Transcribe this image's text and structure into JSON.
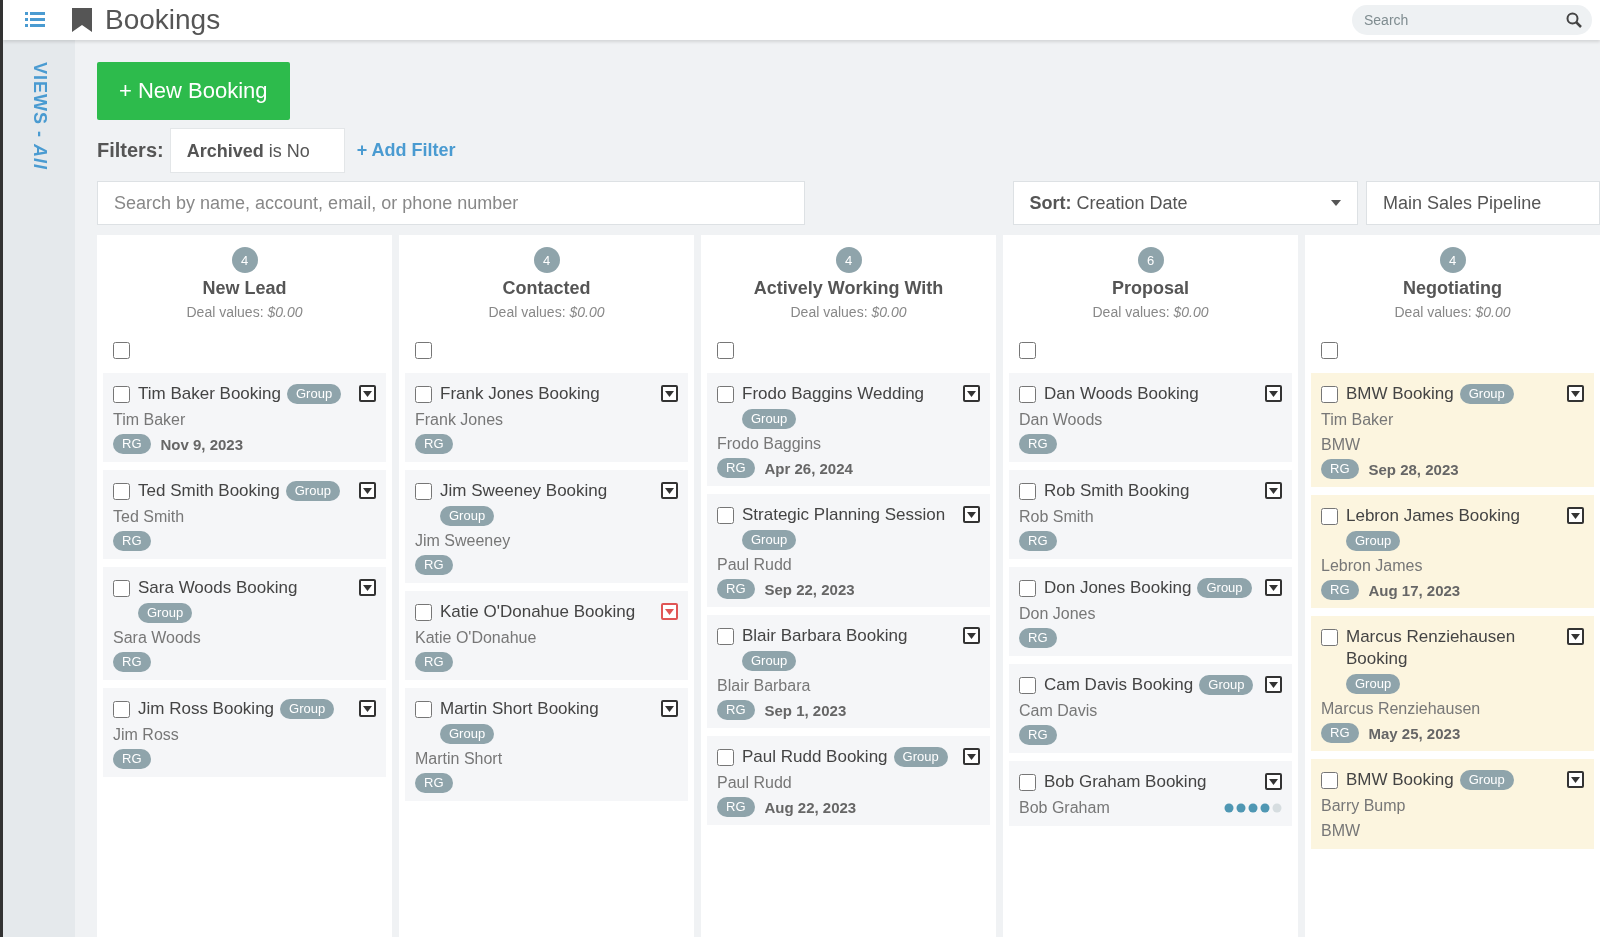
{
  "header": {
    "title": "Bookings",
    "search": {
      "placeholder": "Search"
    }
  },
  "sidebar": {
    "label": "VIEWS - *All*"
  },
  "toolbar": {
    "new_button": "+ New Booking",
    "filters_label": "Filters:",
    "filter": "**Archived** is No",
    "add_filter": "+ Add Filter",
    "search": {
      "placeholder": "Search by name, account, email, or phone number"
    },
    "sort": "**Sort:** Creation Date",
    "pipeline": "Main Sales Pipeline"
  },
  "columns": [
    {
      "count": "4",
      "name": "New Lead",
      "deal": "Deal values: *$0.00*",
      "checked": false,
      "cards": [
        {
          "title": "Tim Baker Booking",
          "badge": "Group",
          "contact": "Tim Baker",
          "tag": "RG",
          "date": "Nov 9, 2023",
          "checked": false,
          "flagged": false,
          "highlighted": false
        },
        {
          "title": "Ted Smith Booking",
          "badge": "Group",
          "contact": "Ted Smith",
          "tag": "RG",
          "checked": false,
          "flagged": false,
          "highlighted": false
        },
        {
          "title": "Sara Woods Booking",
          "badge": "Group",
          "contact": "Sara Woods",
          "tag": "RG",
          "checked": false,
          "flagged": false,
          "highlighted": false
        },
        {
          "title": "Jim Ross Booking",
          "badge": "Group",
          "contact": "Jim Ross",
          "tag": "RG",
          "checked": false,
          "flagged": false,
          "highlighted": false
        }
      ]
    },
    {
      "count": "4",
      "name": "Contacted",
      "deal": "Deal values: *$0.00*",
      "checked": false,
      "cards": [
        {
          "title": "Frank Jones Booking",
          "contact": "Frank Jones",
          "tag": "RG",
          "checked": false,
          "flagged": false,
          "highlighted": false
        },
        {
          "title": "Jim Sweeney Booking",
          "badge": "Group",
          "contact": "Jim Sweeney",
          "tag": "RG",
          "checked": false,
          "flagged": false,
          "highlighted": false
        },
        {
          "title": "Katie O'Donahue Booking",
          "contact": "Katie O'Donahue",
          "tag": "RG",
          "checked": false,
          "flagged": true,
          "highlighted": false
        },
        {
          "title": "Martin Short Booking",
          "badge": "Group",
          "contact": "Martin Short",
          "tag": "RG",
          "checked": false,
          "flagged": false,
          "highlighted": false
        }
      ]
    },
    {
      "count": "4",
      "name": "Actively Working With",
      "deal": "Deal values: *$0.00*",
      "checked": false,
      "cards": [
        {
          "title": "Frodo Baggins Wedding",
          "badge": "Group",
          "contact": "Frodo Baggins",
          "tag": "RG",
          "date": "Apr 26, 2024",
          "checked": false,
          "flagged": false,
          "highlighted": false
        },
        {
          "title": "Strategic Planning Session",
          "badge": "Group",
          "contact": "Paul Rudd",
          "tag": "RG",
          "date": "Sep 22, 2023",
          "checked": false,
          "flagged": false,
          "highlighted": false
        },
        {
          "title": "Blair Barbara Booking",
          "badge": "Group",
          "contact": "Blair Barbara",
          "tag": "RG",
          "date": "Sep 1, 2023",
          "checked": false,
          "flagged": false,
          "highlighted": false
        },
        {
          "title": "Paul Rudd Booking",
          "badge": "Group",
          "contact": "Paul Rudd",
          "tag": "RG",
          "date": "Aug 22, 2023",
          "checked": false,
          "flagged": false,
          "highlighted": false
        }
      ]
    },
    {
      "count": "6",
      "name": "Proposal",
      "deal": "Deal values: *$0.00*",
      "checked": false,
      "cards": [
        {
          "title": "Dan Woods Booking",
          "contact": "Dan Woods",
          "tag": "RG",
          "checked": false,
          "flagged": false,
          "highlighted": false
        },
        {
          "title": "Rob Smith Booking",
          "contact": "Rob Smith",
          "tag": "RG",
          "checked": false,
          "flagged": false,
          "highlighted": false
        },
        {
          "title": "Don Jones Booking",
          "badge": "Group",
          "contact": "Don Jones",
          "tag": "RG",
          "checked": false,
          "flagged": false,
          "highlighted": false
        },
        {
          "title": "Cam Davis Booking",
          "badge": "Group",
          "contact": "Cam Davis",
          "tag": "RG",
          "checked": false,
          "flagged": false,
          "highlighted": false
        },
        {
          "title": "Bob Graham Booking",
          "contact": "Bob Graham",
          "loading": true,
          "checked": false,
          "flagged": false,
          "highlighted": false
        }
      ]
    },
    {
      "count": "4",
      "name": "Negotiating",
      "deal": "Deal values: *$0.00*",
      "checked": false,
      "cards": [
        {
          "title": "BMW Booking",
          "badge": "Group",
          "contact": "Tim Baker",
          "account": "BMW",
          "tag": "RG",
          "date": "Sep 28, 2023",
          "checked": false,
          "flagged": false,
          "highlighted": true
        },
        {
          "title": "Lebron James Booking",
          "badge": "Group",
          "contact": "Lebron James",
          "tag": "RG",
          "date": "Aug 17, 2023",
          "checked": false,
          "flagged": false,
          "highlighted": true
        },
        {
          "title": "Marcus Renziehausen Booking",
          "badge": "Group",
          "contact": "Marcus Renziehausen",
          "tag": "RG",
          "date": "May 25, 2023",
          "checked": false,
          "flagged": false,
          "highlighted": true
        },
        {
          "title": "BMW Booking",
          "badge": "Group",
          "contact": "Barry Bump",
          "account": "BMW",
          "checked": false,
          "flagged": false,
          "highlighted": true
        }
      ]
    }
  ]
}
